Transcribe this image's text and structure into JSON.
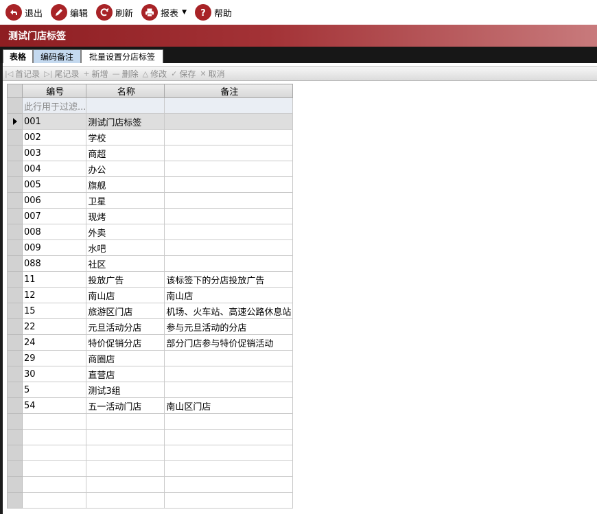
{
  "toolbar": {
    "buttons": [
      {
        "label": "退出",
        "icon": "exit-icon"
      },
      {
        "label": "编辑",
        "icon": "edit-icon"
      },
      {
        "label": "刷新",
        "icon": "refresh-icon"
      },
      {
        "label": "报表",
        "icon": "print-icon"
      },
      {
        "label": "帮助",
        "icon": "help-icon"
      }
    ]
  },
  "window_title": "测试门店标签",
  "tabs": [
    {
      "label": "表格"
    },
    {
      "label": "编码备注"
    },
    {
      "label": "批量设置分店标签"
    }
  ],
  "navigator": {
    "first": "首记录",
    "last": "尾记录",
    "add": "新增",
    "delete": "删除",
    "edit": "修改",
    "save": "保存",
    "cancel": "取消"
  },
  "grid": {
    "columns": [
      "编号",
      "名称",
      "备注"
    ],
    "filter_placeholder": "此行用于过滤...",
    "selected_row": 0,
    "rows": [
      {
        "code": "001",
        "name": "测试门店标签",
        "note": ""
      },
      {
        "code": "002",
        "name": "学校",
        "note": ""
      },
      {
        "code": "003",
        "name": "商超",
        "note": ""
      },
      {
        "code": "004",
        "name": "办公",
        "note": ""
      },
      {
        "code": "005",
        "name": "旗舰",
        "note": ""
      },
      {
        "code": "006",
        "name": "卫星",
        "note": ""
      },
      {
        "code": "007",
        "name": "现烤",
        "note": ""
      },
      {
        "code": "008",
        "name": "外卖",
        "note": ""
      },
      {
        "code": "009",
        "name": "水吧",
        "note": ""
      },
      {
        "code": "088",
        "name": "社区",
        "note": ""
      },
      {
        "code": "11",
        "name": "投放广告",
        "note": "该标签下的分店投放广告"
      },
      {
        "code": "12",
        "name": "南山店",
        "note": "南山店"
      },
      {
        "code": "15",
        "name": "旅游区门店",
        "note": "机场、火车站、高速公路休息站"
      },
      {
        "code": "22",
        "name": "元旦活动分店",
        "note": "参与元旦活动的分店"
      },
      {
        "code": "24",
        "name": "特价促销分店",
        "note": "部分门店参与特价促销活动"
      },
      {
        "code": "29",
        "name": "商圈店",
        "note": ""
      },
      {
        "code": "30",
        "name": "直营店",
        "note": ""
      },
      {
        "code": "5",
        "name": "测试3组",
        "note": ""
      },
      {
        "code": "54",
        "name": "五一活动门店",
        "note": "南山区门店"
      }
    ]
  }
}
